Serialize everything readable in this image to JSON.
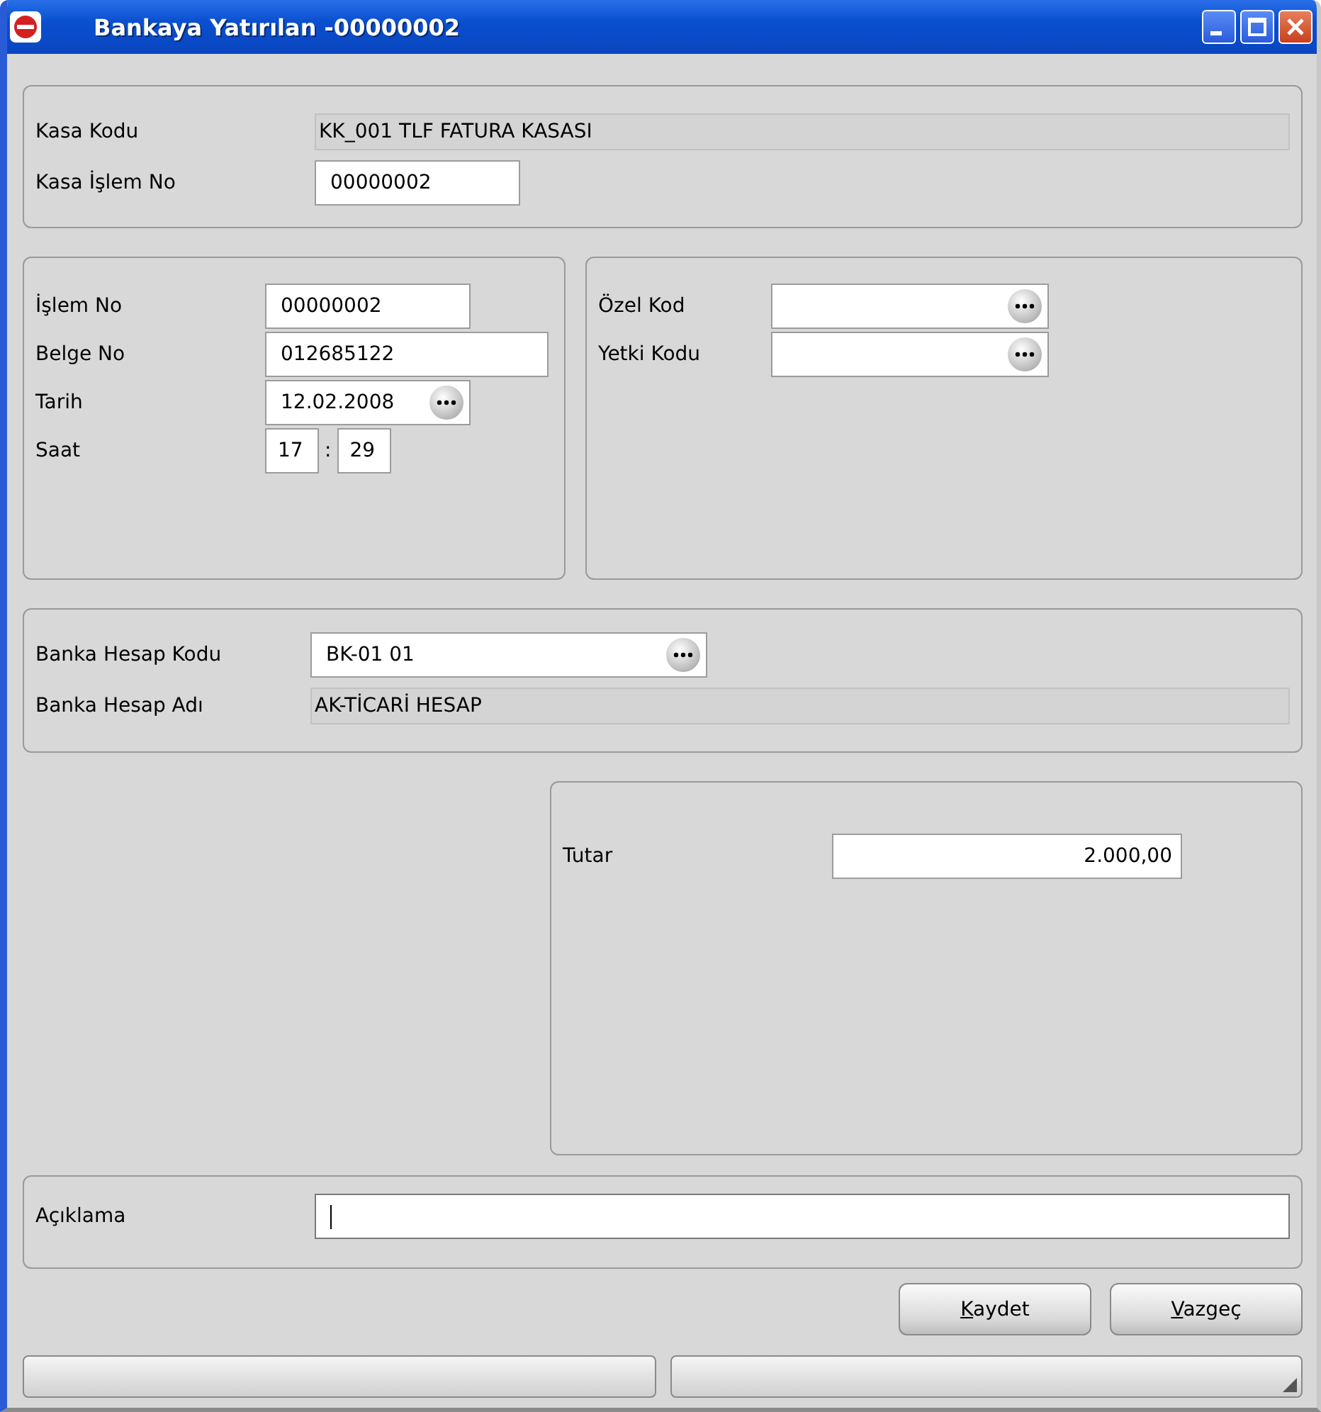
{
  "window": {
    "title": "Bankaya Yatırılan -00000002"
  },
  "kasa": {
    "fields": [
      {
        "label": "Kasa Kodu",
        "value": "KK_001 TLF FATURA KASASI",
        "kind": "display"
      },
      {
        "label": "Kasa İşlem No",
        "value": "00000002",
        "kind": "text"
      }
    ]
  },
  "islem": {
    "fields": [
      {
        "label": "İşlem No",
        "value": "00000002",
        "kind": "text"
      },
      {
        "label": "Belge No",
        "value": "012685122",
        "kind": "text"
      },
      {
        "label": "Tarih",
        "value": "12.02.2008",
        "kind": "lookup"
      },
      {
        "label": "Saat",
        "kind": "time",
        "hour": "17",
        "separator": ":",
        "minute": "29"
      }
    ]
  },
  "kodlar": {
    "fields": [
      {
        "label": "Özel Kod",
        "kind": "lookup"
      },
      {
        "label": "Yetki Kodu",
        "kind": "lookup"
      }
    ]
  },
  "banka": {
    "fields": [
      {
        "label": "Banka Hesap Kodu",
        "value": "BK-01 01",
        "kind": "lookup"
      },
      {
        "label": "Banka Hesap Adı",
        "value": "AK-TİCARİ HESAP",
        "kind": "display"
      }
    ]
  },
  "tutar": {
    "fields": [
      {
        "label": "Tutar",
        "value": "2.000,00",
        "kind": "amount"
      }
    ]
  },
  "aciklama": {
    "fields": [
      {
        "label": "Açıklama",
        "kind": "text",
        "focused": true
      }
    ]
  },
  "buttons": [
    {
      "label": "Kaydet"
    },
    {
      "label": "Vazgeç"
    }
  ]
}
